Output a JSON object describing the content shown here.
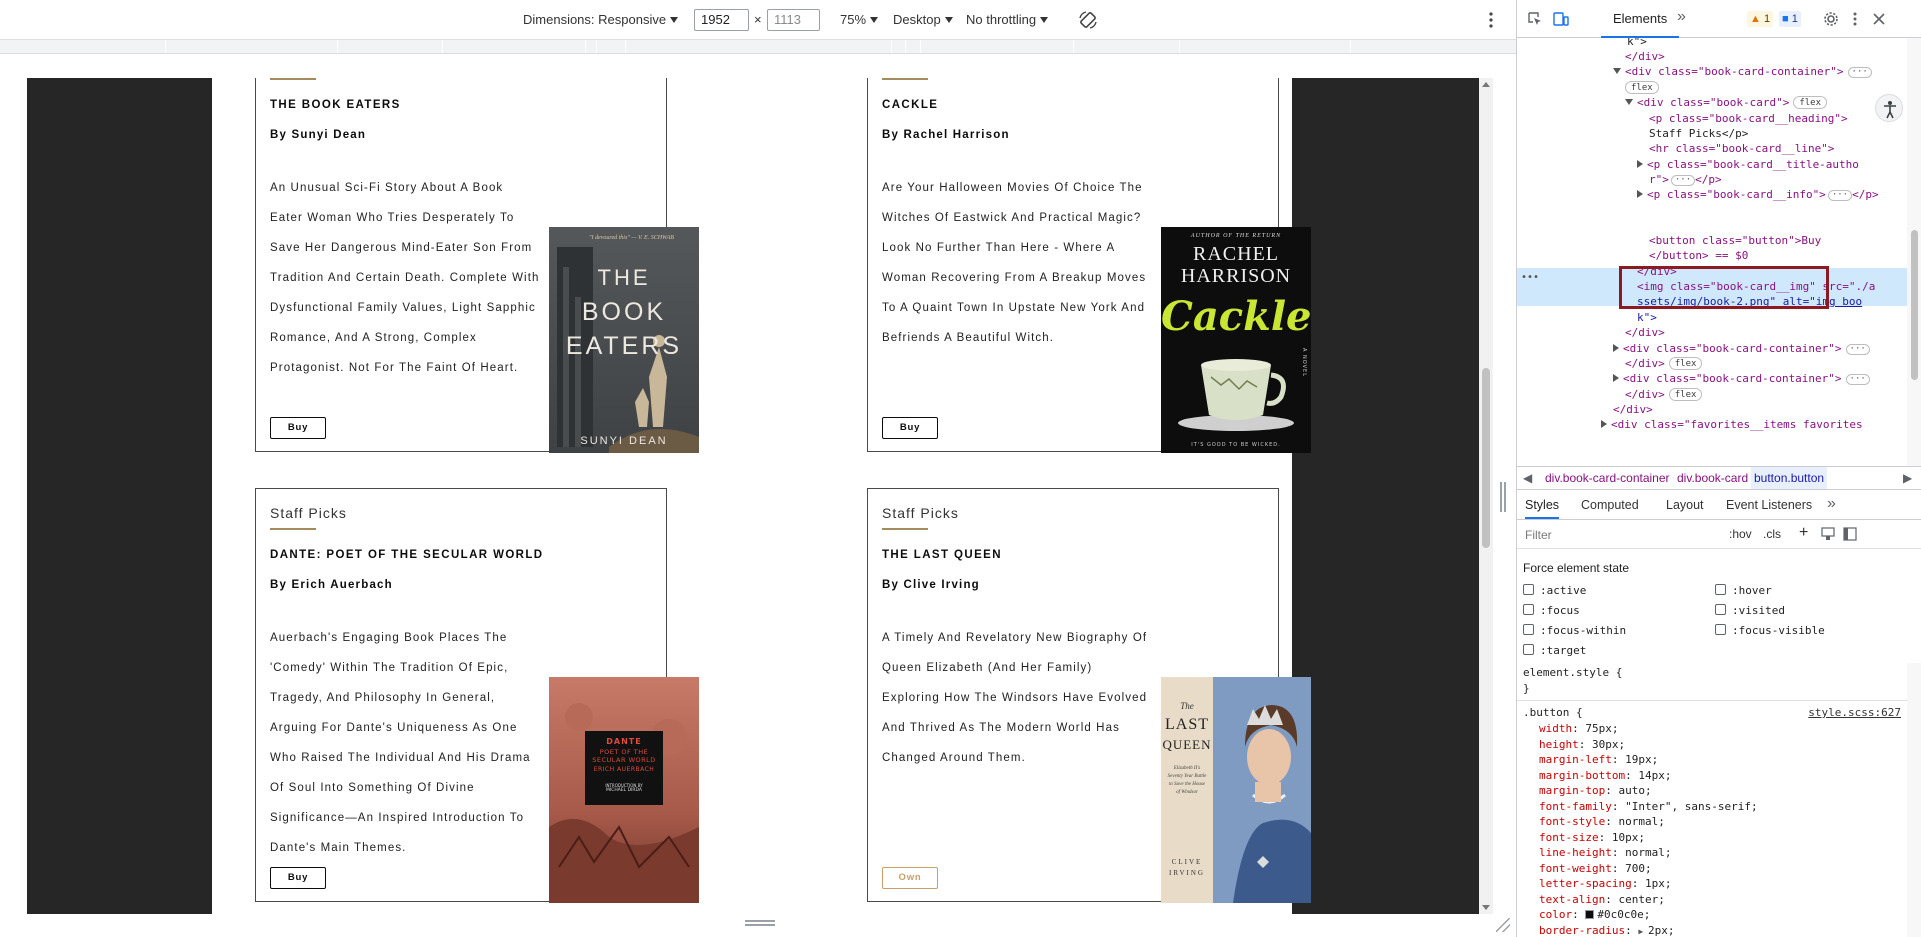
{
  "device_toolbar": {
    "dimensions_label": "Dimensions: Responsive",
    "width_value": "1952",
    "times": "×",
    "height_placeholder": "1113",
    "zoom": "75%",
    "device_type": "Desktop",
    "throttling": "No throttling"
  },
  "books": [
    {
      "title": "THE BOOK EATERS",
      "author": "By Sunyi Dean",
      "info": "An Unusual Sci-Fi Story About A Book Eater Woman Who Tries Desperately To Save Her Dangerous Mind-Eater Son From Tradition And Certain Death. Complete With Dysfunctional Family Values, Light Sapphic Romance, And A Strong, Complex Protagonist. Not For The Faint Of Heart.",
      "button": "Buy",
      "cover_lines": [
        "THE",
        "BOOK",
        "EATERS"
      ],
      "cover_author": "SUNYI DEAN",
      "cover_quote": "\"I devoured this\" — V. E. SCHWAB"
    },
    {
      "title": "CACKLE",
      "author": "By Rachel Harrison",
      "info": "Are Your Halloween Movies Of Choice The Witches Of Eastwick And Practical Magic? Look No Further Than Here - Where A Woman Recovering From A Breakup Moves To A Quaint Town In Upstate New York And Befriends A Beautiful Witch.",
      "button": "Buy",
      "cover_top": "AUTHOR OF THE RETURN",
      "cover_author_lines": [
        "RACHEL",
        "HARRISON"
      ],
      "cover_title": "Cackle",
      "cover_bottom": "IT'S GOOD TO BE WICKED.",
      "cover_side": "A NOVEL"
    },
    {
      "heading": "Staff Picks",
      "title": "DANTE: POET OF THE SECULAR WORLD",
      "author": "By Erich Auerbach",
      "info": "Auerbach's Engaging Book Places The 'Comedy' Within The Tradition Of Epic, Tragedy, And Philosophy In General, Arguing For Dante's Uniqueness As One Who Raised The Individual And His Drama Of Soul Into Something Of Divine Significance—An Inspired Introduction To Dante's Main Themes.",
      "button": "Buy",
      "cover_lines": [
        "DANTE",
        "POET OF THE",
        "SECULAR WORLD"
      ],
      "cover_author": "ERICH AUERBACH",
      "cover_intro": "INTRODUCTION BY",
      "cover_intro_name": "MICHAEL DIRDA"
    },
    {
      "heading": "Staff Picks",
      "title": "THE LAST QUEEN",
      "author": "By Clive Irving",
      "info": "A Timely And Revelatory New Biography Of Queen Elizabeth (And Her Family) Exploring How The Windsors Have Evolved And Thrived As The Modern World Has Changed Around Them.",
      "button": "Own",
      "cover_the": "The",
      "cover_lines": [
        "LAST",
        "QUEEN"
      ],
      "cover_sub": "Elizabeth II's Seventy Year Battle to Save the House of Windsor",
      "cover_author_lines": [
        "CLIVE",
        "IRVING"
      ]
    }
  ],
  "devtools": {
    "tab_elements": "Elements",
    "more_tabs": "»",
    "warnings": "1",
    "messages": "1",
    "tree": [
      {
        "kind": "text",
        "text": "k\">"
      },
      {
        "kind": "close",
        "text": "</div>"
      },
      {
        "kind": "open",
        "text": "<div class=\"book-card-container\">"
      },
      {
        "kind": "badge",
        "text": "flex"
      },
      {
        "kind": "open",
        "text": "<div class=\"book-card\">"
      },
      {
        "kind": "open",
        "text": "<p class=\"book-card__heading\">"
      },
      {
        "kind": "text",
        "text": "Staff Picks</p>"
      },
      {
        "kind": "open",
        "text": "<hr class=\"book-card__line\">"
      },
      {
        "kind": "open",
        "text": "<p class=\"book-card__title-autho"
      },
      {
        "kind": "text",
        "text": "r\">"
      },
      {
        "kind": "open",
        "text": "<p class=\"book-card__info\">"
      },
      {
        "kind": "open",
        "text": "<button class=\"button\">Buy"
      },
      {
        "kind": "text",
        "text": "</button> == $0"
      },
      {
        "kind": "close",
        "text": "</div>"
      },
      {
        "kind": "open",
        "text": "<img class=\"book-card__img\" src=\"./a"
      },
      {
        "kind": "text",
        "text": "ssets/img/book-2.png\" alt=\"img boo"
      },
      {
        "kind": "text",
        "text": "k\">"
      },
      {
        "kind": "close",
        "text": "</div>"
      },
      {
        "kind": "open",
        "text": "<div class=\"book-card-container\">"
      },
      {
        "kind": "close",
        "text": "</div>"
      },
      {
        "kind": "open",
        "text": "<div class=\"book-card-container\">"
      },
      {
        "kind": "close",
        "text": "</div>"
      },
      {
        "kind": "close",
        "text": "</div>"
      },
      {
        "kind": "open",
        "text": "<div class=\"favorites__items favorites"
      }
    ],
    "breadcrumbs": [
      "div.book-card-container",
      "div.book-card",
      "button.button"
    ],
    "styles_tabs": [
      "Styles",
      "Computed",
      "Layout",
      "Event Listeners"
    ],
    "filter_placeholder": "Filter",
    "hov": ":hov",
    "cls": ".cls",
    "force_state_title": "Force element state",
    "force_states": [
      ":active",
      ":hover",
      ":focus",
      ":visited",
      ":focus-within",
      ":focus-visible",
      ":target"
    ],
    "element_style": "element.style {",
    "element_style_close": "}",
    "rule_selector": ".button {",
    "rule_source": "style.scss:627",
    "rule_props": [
      {
        "prop": "width",
        "value": "75px;"
      },
      {
        "prop": "height",
        "value": "30px;"
      },
      {
        "prop": "margin-left",
        "value": "19px;"
      },
      {
        "prop": "margin-bottom",
        "value": "14px;"
      },
      {
        "prop": "margin-top",
        "value": "auto;"
      },
      {
        "prop": "font-family",
        "value": "\"Inter\", sans-serif;"
      },
      {
        "prop": "font-style",
        "value": "normal;"
      },
      {
        "prop": "font-size",
        "value": "10px;"
      },
      {
        "prop": "line-height",
        "value": "normal;"
      },
      {
        "prop": "font-weight",
        "value": "700;"
      },
      {
        "prop": "letter-spacing",
        "value": "1px;"
      },
      {
        "prop": "text-align",
        "value": "center;"
      },
      {
        "prop": "color",
        "value": "#0c0c0e;"
      },
      {
        "prop": "border-radius",
        "value": "2px;"
      }
    ]
  },
  "colors": {
    "accent_line": "#a48b5c",
    "selection_highlight": "#cfe8fc",
    "annotation_box": "#8b1a22",
    "own_button": "#c9a06a"
  }
}
